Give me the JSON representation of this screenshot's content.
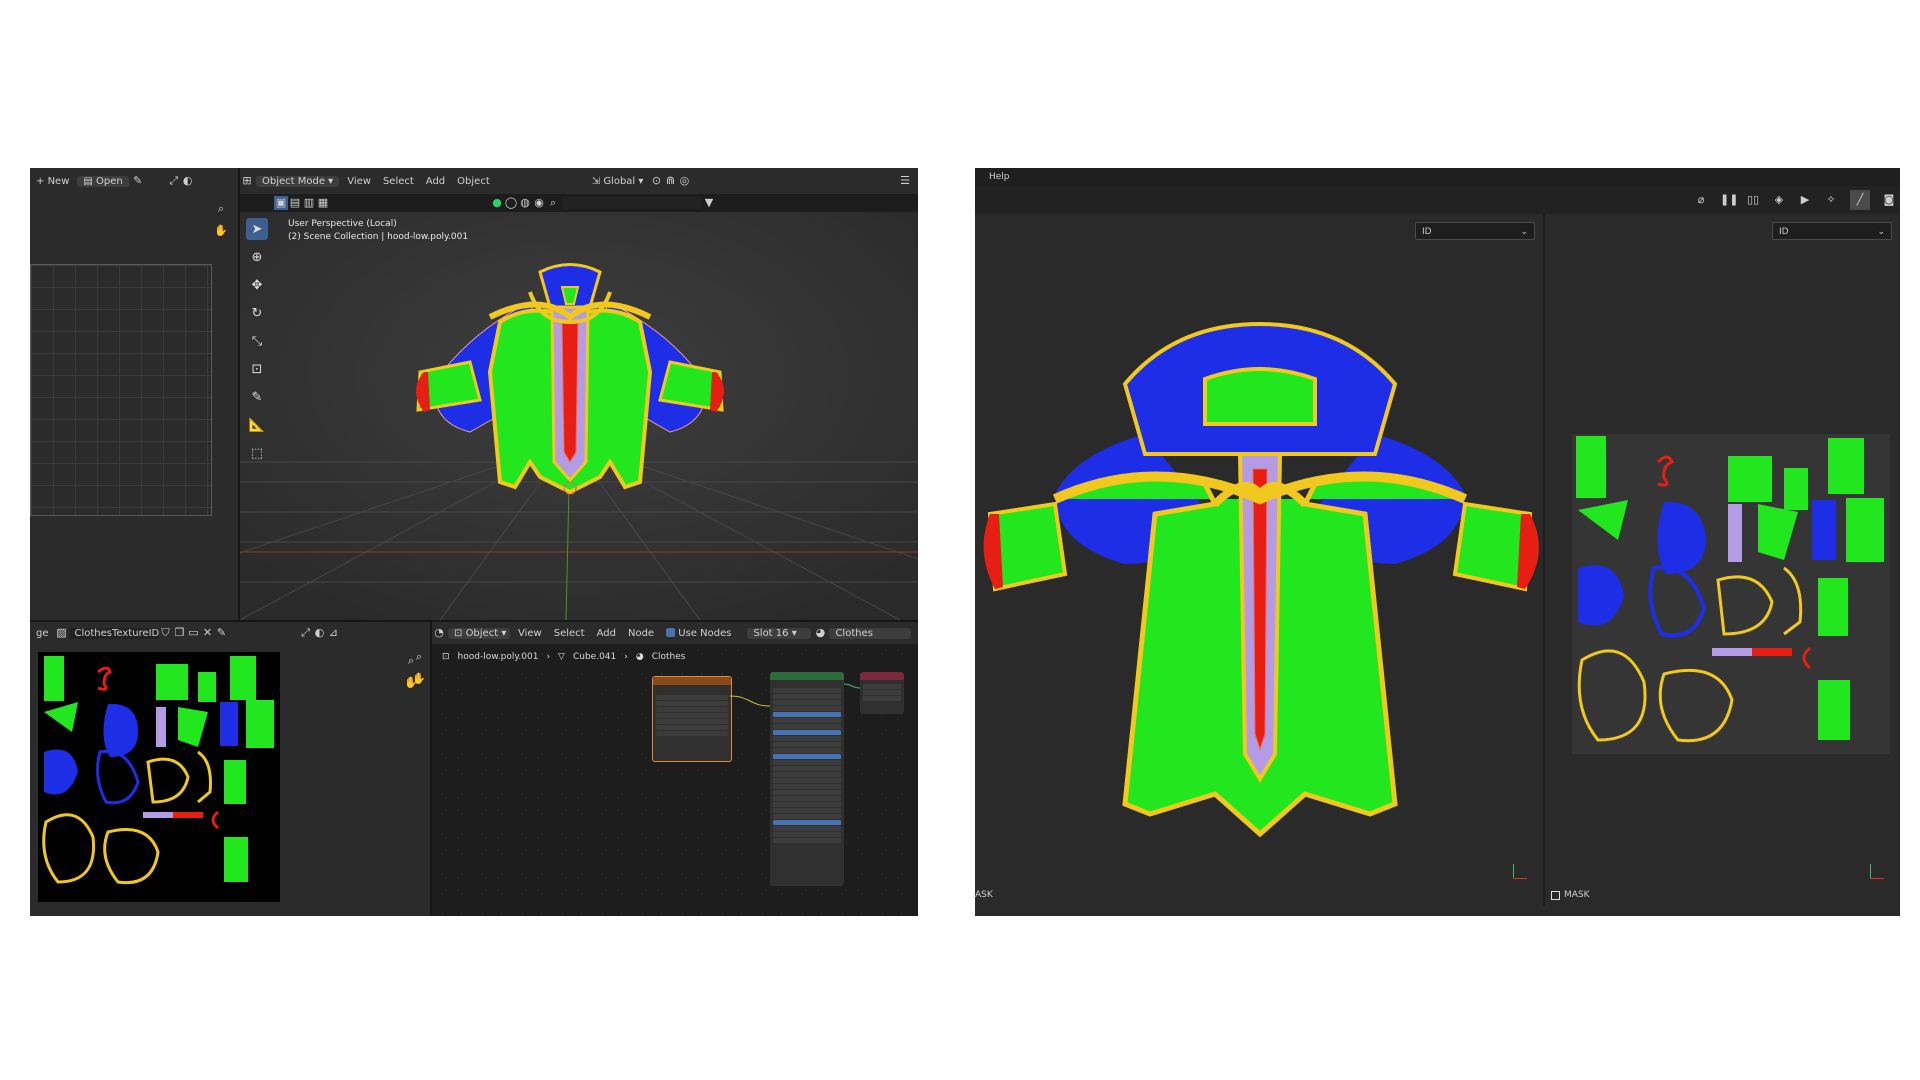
{
  "blender": {
    "image_editor_header": {
      "new_label": "New",
      "open_label": "Open"
    },
    "viewport_header": {
      "mode": "Object Mode",
      "menus": [
        "View",
        "Select",
        "Add",
        "Object"
      ],
      "transform_orientation": "Global"
    },
    "viewport_overlay": {
      "perspective": "User Perspective (Local)",
      "collection": "(2) Scene Collection | hood-low.poly.001"
    },
    "uv_editor_header": {
      "editor_label": "ge",
      "image_name": "ClothesTextureID"
    },
    "node_editor_header": {
      "object_type": "Object",
      "menus": [
        "View",
        "Select",
        "Add",
        "Node"
      ],
      "use_nodes_label": "Use Nodes",
      "slot": "Slot 16",
      "material": "Clothes"
    },
    "breadcrumb": {
      "object": "hood-low.poly.001",
      "mesh": "Cube.041",
      "material": "Clothes"
    }
  },
  "painter": {
    "menu_help": "Help",
    "viewport_3d_dropdown": "ID",
    "viewport_2d_dropdown": "ID",
    "mask_left": "ASK",
    "mask_right": "MASK"
  },
  "colors": {
    "green": "#22e61e",
    "blue": "#1e2ee6",
    "yellow": "#f0c81e",
    "red": "#e61e14",
    "lavender": "#b49be6"
  }
}
